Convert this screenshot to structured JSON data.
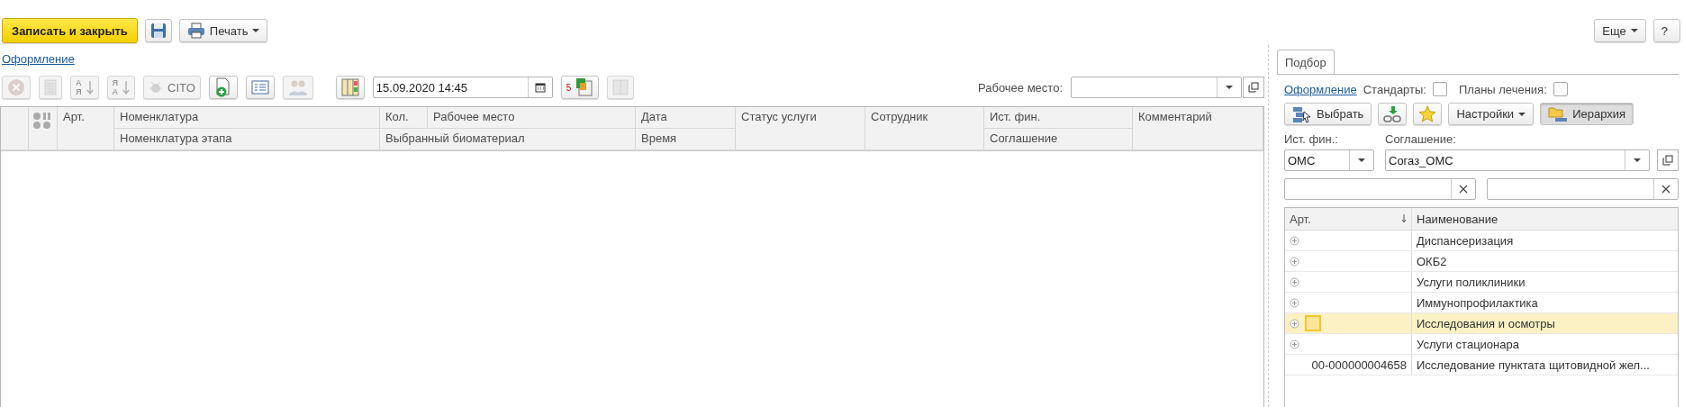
{
  "command_bar": {
    "buttons": [
      {
        "kind": "primary",
        "label": "Записать и закрыть"
      },
      {
        "kind": "save"
      },
      {
        "kind": "print",
        "label": "Печать",
        "dropdown": true
      }
    ],
    "right_buttons": [
      {
        "label": "Еще",
        "dropdown": true
      },
      {
        "label": "?",
        "dropdown": false
      }
    ]
  },
  "left": {
    "link": "Оформление",
    "toolbar": [
      {
        "kind": "cancel",
        "disabled": true
      },
      {
        "kind": "doc",
        "disabled": true
      },
      {
        "kind": "sort-asc",
        "glyphs": [
          "А",
          "Я"
        ],
        "disabled": true
      },
      {
        "kind": "sort-desc",
        "glyphs": [
          "Я",
          "А"
        ],
        "disabled": true
      },
      {
        "kind": "cito",
        "label": "CITO",
        "disabled": true
      },
      {
        "kind": "add",
        "disabled": false
      },
      {
        "kind": "list",
        "disabled": false
      },
      {
        "kind": "people",
        "disabled": true
      },
      {
        "kind": "columns",
        "disabled": false
      },
      {
        "kind": "date",
        "value": "15.09.2020 14:45"
      },
      {
        "kind": "calendar",
        "glyphs": [
          "5"
        ],
        "disabled": false
      },
      {
        "kind": "panel",
        "disabled": true
      }
    ],
    "workplace": {
      "label": "Рабочее место:"
    },
    "table": {
      "columns": [
        {
          "top": "Арт."
        },
        {
          "top": "Номенклатура",
          "bottom": "Номенклатура этапа"
        },
        {
          "top": "Кол.",
          "bottom": "Выбранный биоматериал"
        },
        {
          "top": "Рабочее место"
        },
        {
          "top": "Дата",
          "bottom": "Время"
        },
        {
          "top": "Статус услуги"
        },
        {
          "top": "Сотрудник"
        },
        {
          "top": "Ист. фин.",
          "bottom": "Соглашение"
        },
        {
          "top": "Комментарий"
        }
      ]
    }
  },
  "right": {
    "tabs": [
      {
        "label": "Подбор",
        "selected": true
      }
    ],
    "link": "Оформление",
    "checkboxes": [
      {
        "label": "Стандарты:",
        "checked": false
      },
      {
        "label": "Планы лечения:",
        "checked": false
      }
    ],
    "buttons": [
      {
        "kind": "select",
        "label": "Выбрать",
        "pressed": false
      },
      {
        "kind": "link",
        "pressed": false
      },
      {
        "kind": "star",
        "pressed": false
      },
      {
        "kind": "menu",
        "label": "Настройки",
        "pressed": false
      },
      {
        "kind": "hierarchy",
        "label": "Иерархия",
        "pressed": true
      }
    ],
    "fin_source": {
      "label": "Ист. фин.:",
      "value": "ОМС"
    },
    "agreement": {
      "label": "Соглашение:",
      "value": "Согаз_ОМС"
    },
    "filters": [
      {
        "clearable": true
      },
      {
        "clearable": true
      }
    ],
    "tree": {
      "columns": [
        "Арт.",
        "Наименование"
      ],
      "rows": [
        {
          "kind": "group",
          "art": "",
          "name": "Диспансеризация",
          "selected": false
        },
        {
          "kind": "group",
          "art": "",
          "name": "ОКБ2",
          "selected": false
        },
        {
          "kind": "group",
          "art": "",
          "name": "Услуги поликлиники",
          "selected": false
        },
        {
          "kind": "group",
          "art": "",
          "name": "Иммунопрофилактика",
          "selected": false
        },
        {
          "kind": "group",
          "art": "",
          "name": "Исследования и осмотры",
          "selected": true
        },
        {
          "kind": "group",
          "art": "",
          "name": "Услуги стационара",
          "selected": false
        },
        {
          "kind": "item",
          "art": "00-000000004658",
          "name": "Исследование пунктата щитовидной жел...",
          "selected": false
        }
      ]
    }
  }
}
